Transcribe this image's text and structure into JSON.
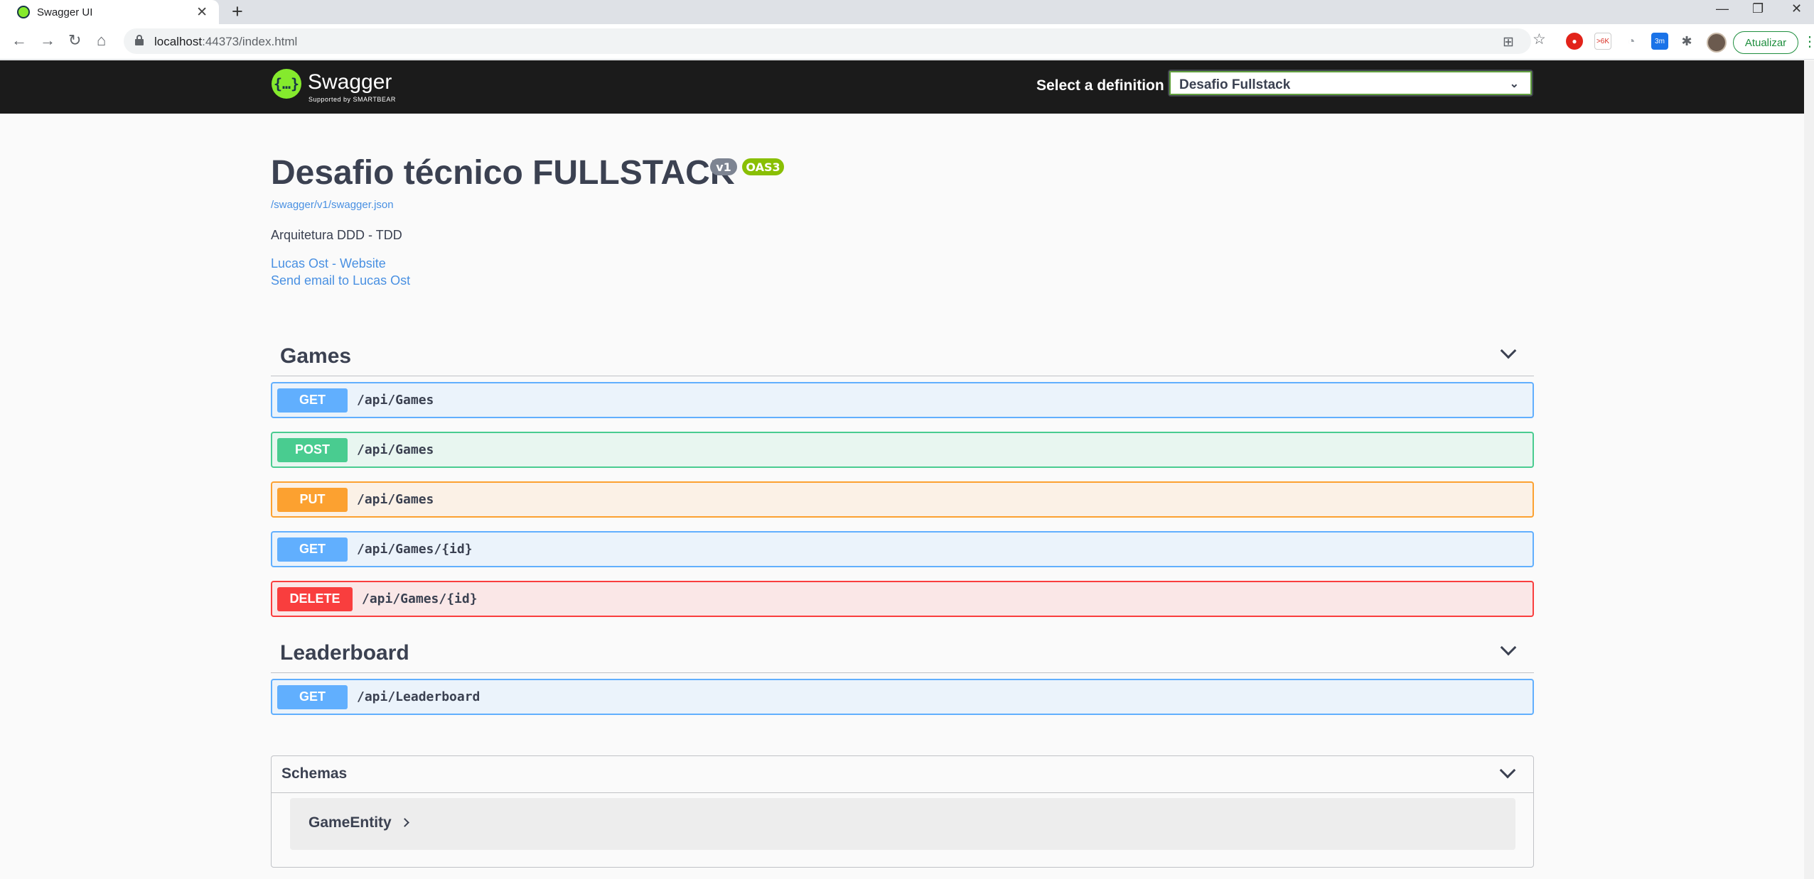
{
  "browser": {
    "tab_title": "Swagger UI",
    "new_tab": "+",
    "url_host": "localhost",
    "url_rest": ":44373/index.html",
    "update_label": "Atualizar",
    "ext_gmail_badge": ">6K",
    "ext_timer_badge": "3m"
  },
  "topbar": {
    "logo_text": "Swagger",
    "logo_sub": "Supported by SMARTBEAR",
    "select_label": "Select a definition",
    "selected_definition": "Desafio Fullstack"
  },
  "info": {
    "title": "Desafio técnico FULLSTACK",
    "version_badge": "v1",
    "oas_badge": "OAS3",
    "spec_link": "/swagger/v1/swagger.json",
    "description": "Arquitetura DDD - TDD",
    "contact_website": "Lucas Ost - Website",
    "contact_email": "Send email to Lucas Ost"
  },
  "tags": [
    {
      "name": "Games",
      "operations": [
        {
          "method": "GET",
          "path": "/api/Games"
        },
        {
          "method": "POST",
          "path": "/api/Games"
        },
        {
          "method": "PUT",
          "path": "/api/Games"
        },
        {
          "method": "GET",
          "path": "/api/Games/{id}"
        },
        {
          "method": "DELETE",
          "path": "/api/Games/{id}"
        }
      ]
    },
    {
      "name": "Leaderboard",
      "operations": [
        {
          "method": "GET",
          "path": "/api/Leaderboard"
        }
      ]
    }
  ],
  "schemas": {
    "title": "Schemas",
    "models": [
      "GameEntity"
    ]
  },
  "colors": {
    "get": "#61affe",
    "post": "#49cc90",
    "put": "#fca130",
    "delete": "#f93e3e",
    "topbar": "#1b1b1b",
    "link": "#4990e2"
  }
}
